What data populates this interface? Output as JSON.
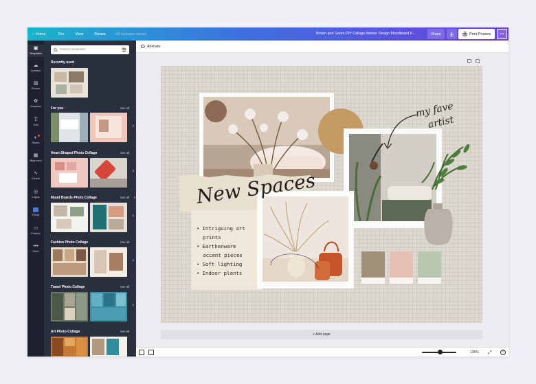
{
  "topbar": {
    "home": "Home",
    "file": "File",
    "view": "View",
    "resize": "Resize",
    "status": "All changes saved",
    "document_title": "Brown and Green DIY Collage Interior Design Moodboard P...",
    "share": "Share",
    "print": "Print Posters",
    "more": "•••"
  },
  "rail": {
    "items": [
      {
        "label": "Templates",
        "icon": "templates-icon"
      },
      {
        "label": "Uploads",
        "icon": "upload-icon"
      },
      {
        "label": "Photos",
        "icon": "photos-icon"
      },
      {
        "label": "Graphics",
        "icon": "graphics-icon"
      },
      {
        "label": "Text",
        "icon": "text-icon"
      },
      {
        "label": "Styles",
        "icon": "styles-icon"
      },
      {
        "label": "Bkground",
        "icon": "background-icon"
      },
      {
        "label": "Charts",
        "icon": "charts-icon"
      },
      {
        "label": "Logos",
        "icon": "logos-icon"
      },
      {
        "label": "Emoji",
        "icon": "emoji-icon"
      },
      {
        "label": "Folders",
        "icon": "folder-icon"
      },
      {
        "label": "More",
        "icon": "more-icon"
      }
    ]
  },
  "panel": {
    "search_placeholder": "Search templates",
    "recently_used": "Recently used",
    "see_all": "See all",
    "sections": [
      {
        "title": "For you"
      },
      {
        "title": "Heart-Shaped Photo Collage"
      },
      {
        "title": "Mood Boards Photo Collage"
      },
      {
        "title": "Fashion Photo Collage"
      },
      {
        "title": "Travel Photo Collage"
      },
      {
        "title": "Art Photo Collage"
      }
    ]
  },
  "editor": {
    "animate": "Animate",
    "add_page": "+ Add page",
    "zoom": "136%"
  },
  "canvas": {
    "handwritten_title": "New Spaces",
    "handwritten_note": "my fave artist",
    "bullets": [
      "Intriguing art",
      "prints",
      "Earthenware",
      "accent pieces",
      "Soft lighting",
      "Indoor plants"
    ],
    "swatches": [
      "#a08f79",
      "#e6c0b3",
      "#b8c8b0"
    ]
  }
}
